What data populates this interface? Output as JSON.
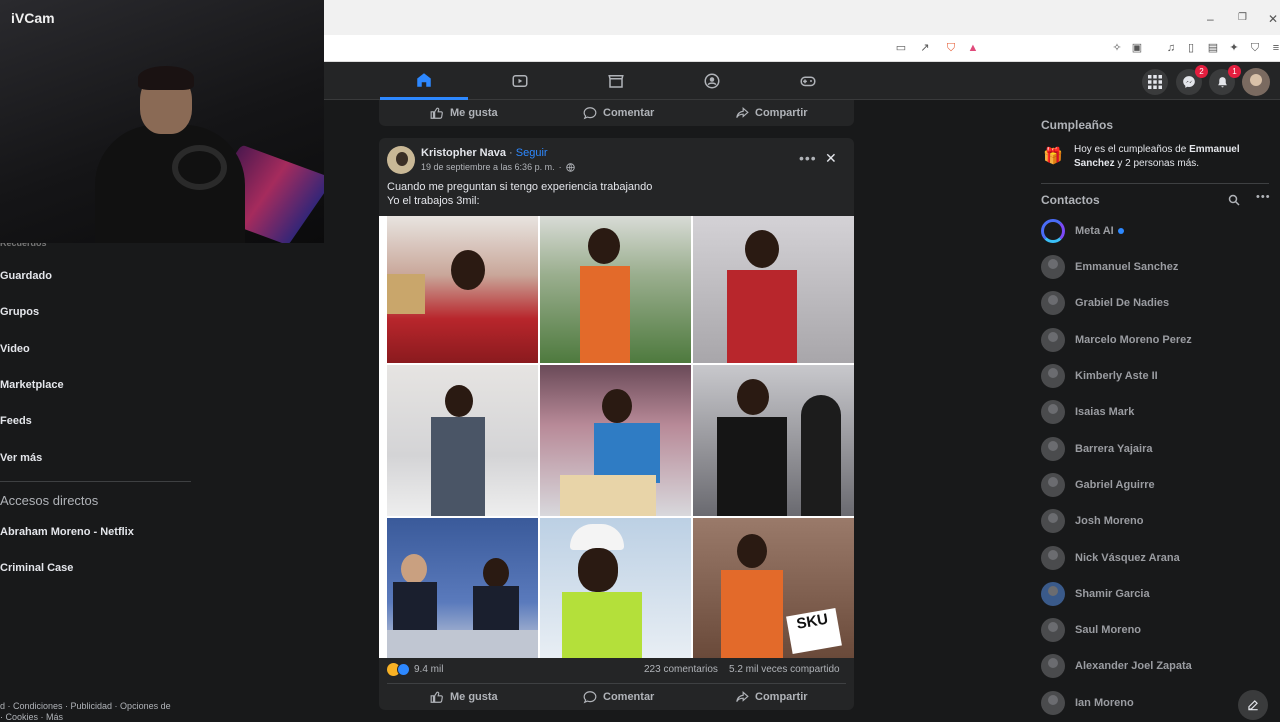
{
  "webcam": {
    "label": "iVCam"
  },
  "browser": {
    "minimize": "–",
    "restore": "❐",
    "close": "✕"
  },
  "topnav": {
    "messenger_badge": "2",
    "notifications_badge": "1"
  },
  "left_sidebar": {
    "cut_top": "Recuerdos",
    "items": [
      "Guardado",
      "Grupos",
      "Video",
      "Marketplace",
      "Feeds",
      "Ver más"
    ],
    "shortcuts_header": "Accesos directos",
    "shortcuts": [
      "Abraham Moreno - Netflix",
      "Criminal Case"
    ],
    "footer_line1": "d · Condiciones · Publicidad · Opciones de",
    "footer_line2": "· Cookies · Más"
  },
  "post_prev": {
    "like": "Me gusta",
    "comment": "Comentar",
    "share": "Compartir"
  },
  "post": {
    "author": "Kristopher Nava",
    "separator": "·",
    "follow": "Seguir",
    "date": "19 de septiembre a las 6:36 p. m.",
    "text_line1": "Cuando me preguntan si tengo experiencia trabajando",
    "text_line2": "Yo el trabajos 3mil:",
    "reactions": "9.4 mil",
    "comments": "223 comentarios",
    "shares": "5.2 mil veces compartido",
    "like": "Me gusta",
    "comment": "Comentar",
    "share": "Compartir",
    "sku_text": "SKU"
  },
  "right_column": {
    "birthdays_header": "Cumpleaños",
    "birthday_prefix": "Hoy es el cumpleaños de ",
    "birthday_name": "Emmanuel Sanchez",
    "birthday_suffix": " y 2 personas más.",
    "contacts_header": "Contactos",
    "contacts": [
      "Meta AI",
      "Emmanuel Sanchez",
      "Grabiel De Nadies",
      "Marcelo Moreno Perez",
      "Kimberly Aste II",
      "Isaias Mark",
      "Barrera Yajaira",
      "Gabriel Aguirre",
      "Josh Moreno",
      "Nick Vásquez Arana",
      "Shamir Garcia",
      "Saul Moreno",
      "Alexander Joel Zapata",
      "Ian Moreno"
    ]
  },
  "colors": {
    "accent": "#2d88ff",
    "bg": "#18191a",
    "card": "#242526",
    "badge": "#e41e3f"
  }
}
